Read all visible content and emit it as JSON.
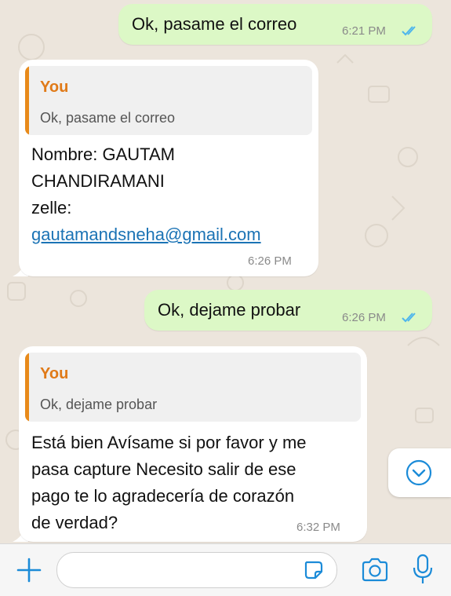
{
  "messages": [
    {
      "type": "outgoing",
      "text": "Ok, pasame el correo",
      "time": "6:21 PM",
      "status": "read"
    },
    {
      "type": "incoming",
      "quote_author": "You",
      "quote_text": "Ok, pasame el correo",
      "lines": [
        "Nombre: GAUTAM",
        "CHANDIRAMANI",
        "zelle:"
      ],
      "link": "gautamandsneha@gmail.com",
      "time": "6:26 PM"
    },
    {
      "type": "outgoing",
      "text": "Ok, dejame probar",
      "time": "6:26 PM",
      "status": "read"
    },
    {
      "type": "incoming",
      "quote_author": "You",
      "quote_text": "Ok, dejame probar",
      "lines": [
        "Está bien Avísame si por favor y me",
        "pasa capture Necesito salir de ese",
        "pago te lo agradecería de corazón",
        "de verdad?"
      ],
      "time": "6:32 PM"
    }
  ],
  "composer": {
    "input_value": ""
  },
  "icons": {
    "attach": "plus-icon",
    "sticker": "sticker-icon",
    "camera": "camera-icon",
    "mic": "microphone-icon",
    "scroll": "chevron-down-icon",
    "read": "double-check-icon"
  },
  "colors": {
    "outgoing_bubble": "#dcf8c6",
    "incoming_bubble": "#ffffff",
    "accent_blue": "#1b8bd8",
    "quote_accent": "#e88a1a",
    "read_ticks": "#4fb6ec"
  }
}
